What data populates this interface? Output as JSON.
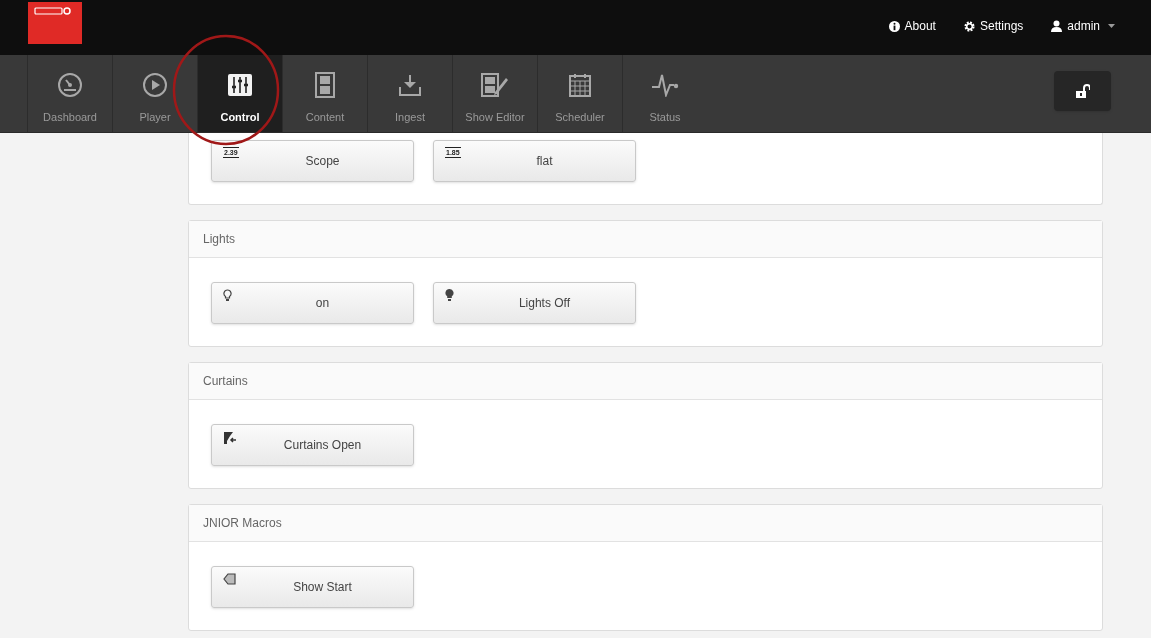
{
  "header": {
    "links": [
      {
        "kind": "info",
        "label": "About"
      },
      {
        "kind": "gear",
        "label": "Settings"
      },
      {
        "kind": "user",
        "label": "admin",
        "dropdown": true
      }
    ]
  },
  "nav": {
    "tabs": [
      {
        "kind": "gauge",
        "label": "Dashboard",
        "selected": false
      },
      {
        "kind": "play",
        "label": "Player",
        "selected": false
      },
      {
        "kind": "sliders",
        "label": "Control",
        "selected": true
      },
      {
        "kind": "film",
        "label": "Content",
        "selected": false
      },
      {
        "kind": "download",
        "label": "Ingest",
        "selected": false
      },
      {
        "kind": "edit",
        "label": "Show Editor",
        "selected": false
      },
      {
        "kind": "calendar",
        "label": "Scheduler",
        "selected": false
      },
      {
        "kind": "pulse",
        "label": "Status",
        "selected": false
      }
    ],
    "locked": false
  },
  "panels": [
    {
      "buttons": [
        {
          "kind": "ratio",
          "icon_text": "2.39",
          "label": "Scope"
        },
        {
          "kind": "ratio",
          "icon_text": "1.85",
          "label": "flat"
        }
      ]
    },
    {
      "title": "Lights",
      "buttons": [
        {
          "kind": "bulb_on",
          "label": "on"
        },
        {
          "kind": "bulb_off",
          "label": "Lights Off"
        }
      ]
    },
    {
      "title": "Curtains",
      "buttons": [
        {
          "kind": "curtains",
          "label": "Curtains Open"
        }
      ]
    },
    {
      "title": "JNIOR Macros",
      "buttons": [
        {
          "kind": "macro",
          "label": "Show Start"
        }
      ]
    }
  ]
}
